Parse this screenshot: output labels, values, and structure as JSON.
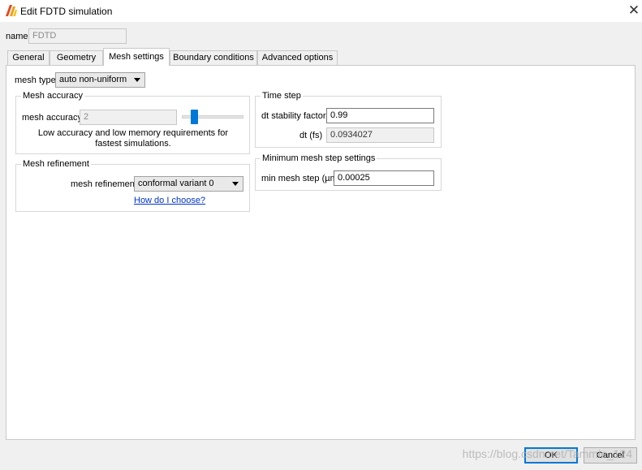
{
  "window": {
    "title": "Edit FDTD simulation",
    "close_glyph": "✕",
    "icon": "lumerical-app-icon"
  },
  "name_field": {
    "label": "name",
    "value": "FDTD"
  },
  "tabs": [
    {
      "label": "General"
    },
    {
      "label": "Geometry"
    },
    {
      "label": "Mesh settings",
      "active": true
    },
    {
      "label": "Boundary conditions"
    },
    {
      "label": "Advanced options"
    }
  ],
  "mesh_type": {
    "label": "mesh type",
    "value": "auto non-uniform"
  },
  "mesh_accuracy": {
    "group_title": "Mesh accuracy",
    "label": "mesh accuracy",
    "value": "2",
    "slider_fraction": 0.17,
    "description": "Low accuracy and low memory requirements for fastest simulations."
  },
  "mesh_refinement": {
    "group_title": "Mesh refinement",
    "label": "mesh refinement",
    "value": "conformal variant 0",
    "help_link": "How do I choose?"
  },
  "time_step": {
    "group_title": "Time step",
    "stability_label": "dt stability factor",
    "stability_value": "0.99",
    "dt_label": "dt (fs)",
    "dt_value": "0.0934027"
  },
  "min_mesh": {
    "group_title": "Minimum mesh step settings",
    "label": "min mesh step (µm)",
    "value": "0.00025"
  },
  "buttons": {
    "ok": "OK",
    "cancel": "Cancel"
  },
  "watermark": "https://blog.csdn.net/Tammie_124",
  "colors": {
    "accent": "#0078d7",
    "link": "#0033cc"
  }
}
